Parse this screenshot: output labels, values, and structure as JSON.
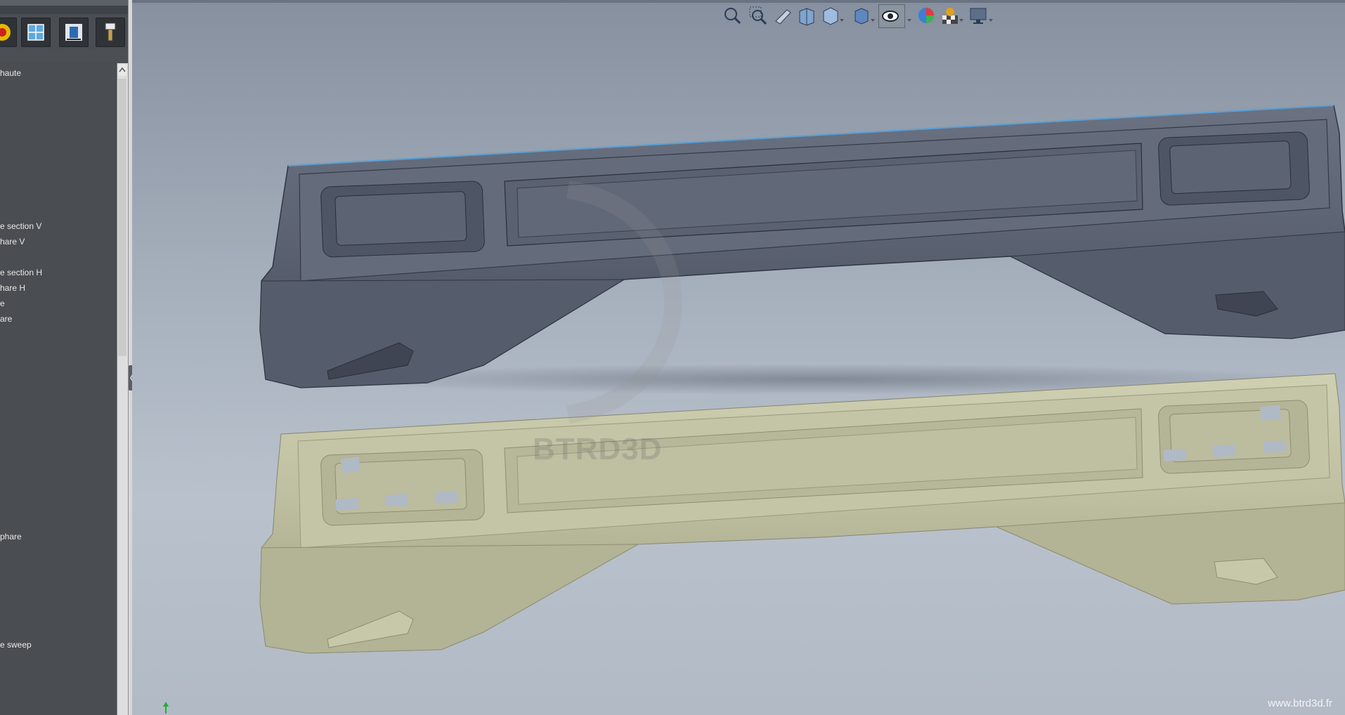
{
  "feature_tree": {
    "items": [
      {
        "label": "haute"
      },
      {
        "label": "e section V"
      },
      {
        "label": "hare V"
      },
      {
        "label": "e section H"
      },
      {
        "label": "hare H"
      },
      {
        "label": "e"
      },
      {
        "label": "are"
      },
      {
        "label": "phare"
      },
      {
        "label": "e sweep"
      }
    ],
    "toolbar_icons": [
      "appearance-icon",
      "section-view-icon",
      "measure-icon",
      "tool-icon"
    ]
  },
  "heads_up_toolbar": {
    "icons": [
      "zoom-to-fit-icon",
      "zoom-to-area-icon",
      "previous-view-icon",
      "section-view-icon",
      "view-orientation-icon",
      "display-style-icon",
      "hide-show-items-icon",
      "edit-appearance-icon",
      "apply-scene-icon",
      "view-settings-icon"
    ]
  },
  "viewport": {
    "watermark": "BTRD3D",
    "credit": "www.btrd3d.fr",
    "colors": {
      "background_top": "#86909f",
      "background_bottom": "#b1bac5",
      "model_dark": "#5c6373",
      "model_light": "#c2c2a4"
    }
  }
}
